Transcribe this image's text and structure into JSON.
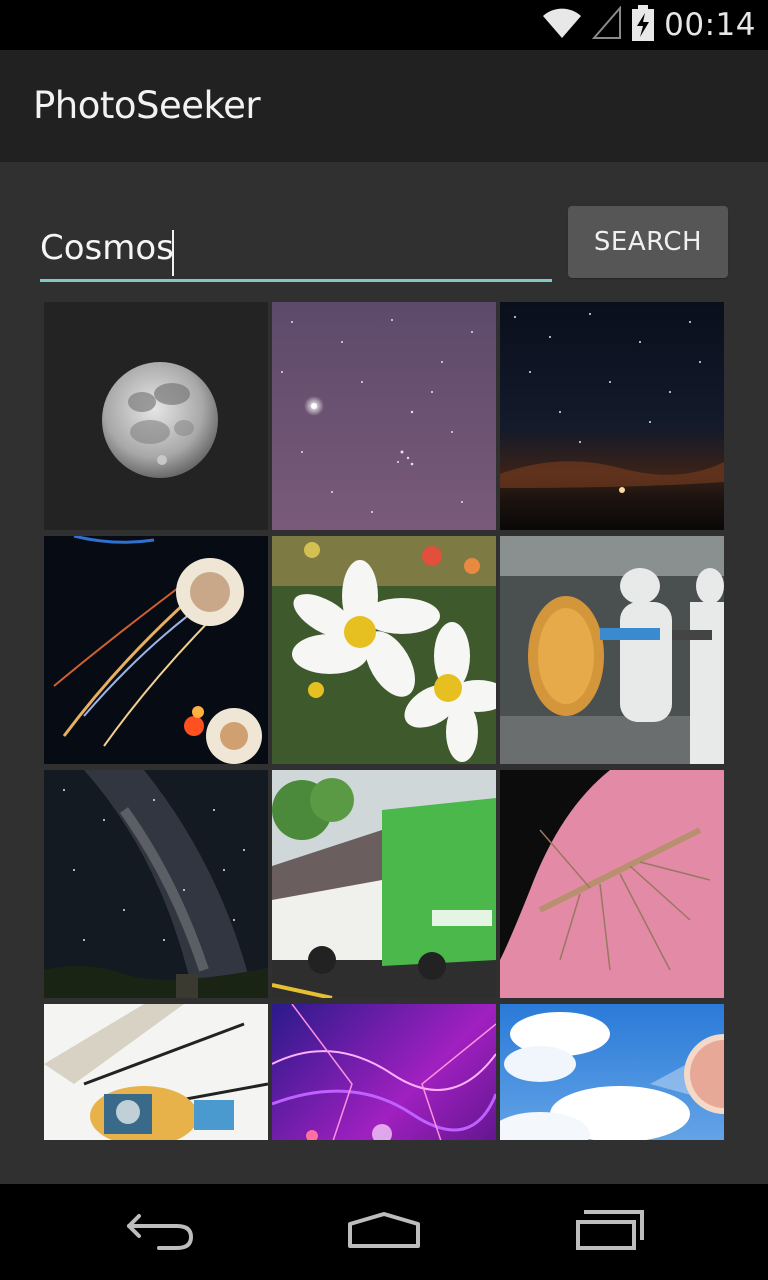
{
  "status_bar": {
    "time": "00:14",
    "icons": [
      "wifi-icon",
      "cell-signal-icon",
      "battery-charging-icon"
    ]
  },
  "action_bar": {
    "title": "PhotoSeeker"
  },
  "search": {
    "value": "Cosmos",
    "button_label": "SEARCH",
    "accent_color": "#7fcbc4"
  },
  "photos": [
    {
      "subject": "full moon"
    },
    {
      "subject": "purple starry sky"
    },
    {
      "subject": "night sky horizon"
    },
    {
      "subject": "fireworks plates"
    },
    {
      "subject": "white cosmos flowers"
    },
    {
      "subject": "cleanroom technicians"
    },
    {
      "subject": "milky way"
    },
    {
      "subject": "green bus"
    },
    {
      "subject": "mosquito on pink petal"
    },
    {
      "subject": "space capsule model"
    },
    {
      "subject": "purple nebula"
    },
    {
      "subject": "blue sky clouds"
    }
  ],
  "nav_bar": {
    "icons": [
      "back-icon",
      "home-icon",
      "recent-apps-icon"
    ]
  }
}
